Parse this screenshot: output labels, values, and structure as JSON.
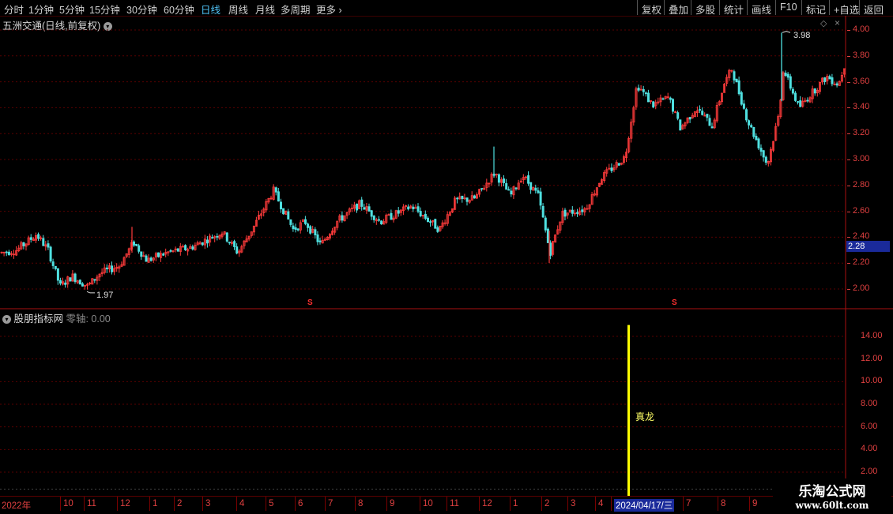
{
  "toolbar": {
    "periods": [
      "分时",
      "1分钟",
      "5分钟",
      "15分钟",
      "30分钟",
      "60分钟",
      "日线",
      "周线",
      "月线",
      "多周期",
      "更多"
    ],
    "active": "日线",
    "more_arrow": "›",
    "right_buttons": [
      "复权",
      "叠加",
      "多股",
      "统计",
      "画线",
      "F10",
      "标记",
      "+自选",
      "返回"
    ]
  },
  "main_panel": {
    "title": "五洲交通(日线,前复权)",
    "collapse_icon": "chevron-down-icon",
    "price_axis": [
      "4.00",
      "3.80",
      "3.60",
      "3.40",
      "3.20",
      "3.00",
      "2.80",
      "2.60",
      "2.40",
      "2.20",
      "2.00"
    ],
    "current_price_tag": "2.28",
    "high_marker": "3.98",
    "low_marker": "1.97",
    "signal_mark": "S"
  },
  "indicator_panel": {
    "title": "股朋指标网",
    "zero_axis_label": "零轴: 0.00",
    "axis": [
      "14.00",
      "12.00",
      "10.00",
      "8.00",
      "6.00",
      "4.00",
      "2.00"
    ],
    "signal_label": "真龙",
    "signal_value": 15.0
  },
  "date_axis": {
    "labels": [
      "2022年",
      "10",
      "11",
      "12",
      "1",
      "2",
      "3",
      "4",
      "5",
      "6",
      "7",
      "8",
      "9",
      "10",
      "11",
      "12",
      "1",
      "2",
      "3",
      "4",
      "2024/04/17/三",
      "7",
      "8",
      "9"
    ],
    "cursor_date": "2024/04/17/三"
  },
  "watermark": {
    "title": "乐淘公式网",
    "url": "www.60lt.com"
  },
  "colors": {
    "up": "#ff3b3b",
    "down": "#4fe0e0",
    "grid": "#5a0000",
    "axis": "#e04040",
    "signal": "#ffff00",
    "cursor_bg": "#1a2a9a"
  }
}
